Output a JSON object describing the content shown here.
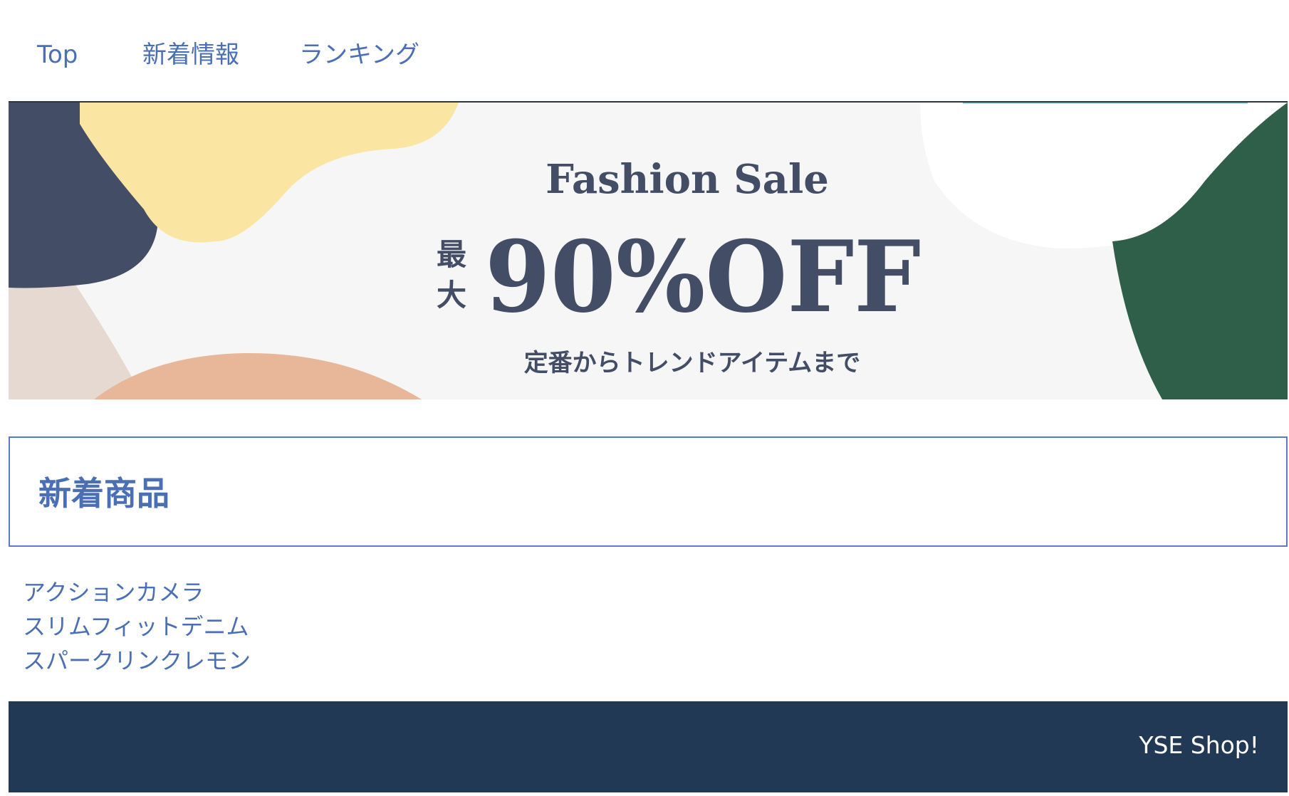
{
  "nav": {
    "items": [
      {
        "label": "Top"
      },
      {
        "label": "新着情報"
      },
      {
        "label": "ランキング"
      }
    ]
  },
  "banner": {
    "title": "Fashion Sale",
    "prefix_line1": "最",
    "prefix_line2": "大",
    "headline": "90%OFF",
    "subtitle": "定番からトレンドアイテムまで",
    "colors": {
      "background": "#f6f6f6",
      "navy": "#434d66",
      "yellow": "#fbe5a2",
      "peach": "#e8b698",
      "beige": "#e5d9d1",
      "green": "#2f5f49"
    }
  },
  "section": {
    "title": "新着商品"
  },
  "products": [
    {
      "name": "アクションカメラ"
    },
    {
      "name": "スリムフィットデニム"
    },
    {
      "name": "スパークリンクレモン"
    }
  ],
  "footer": {
    "brand": "YSE Shop!"
  }
}
